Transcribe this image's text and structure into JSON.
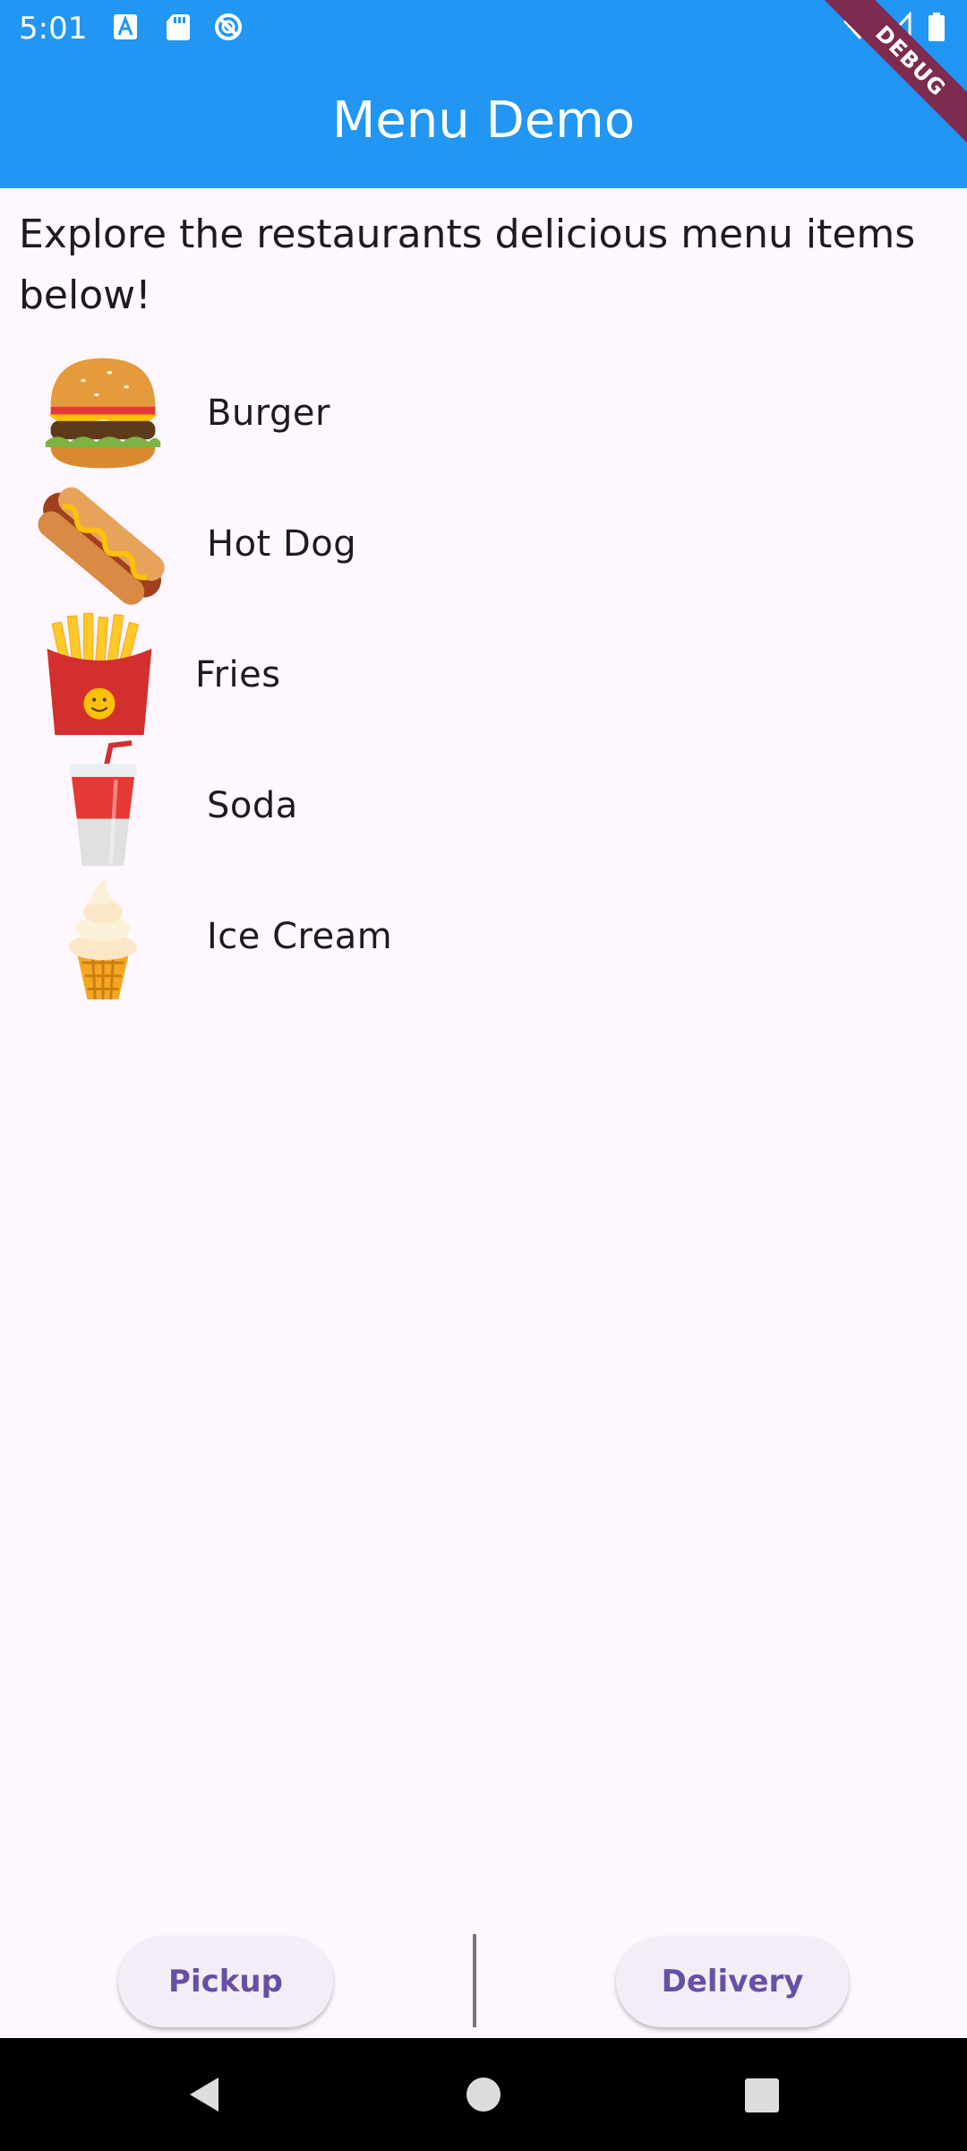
{
  "status_bar": {
    "time": "5:01",
    "left_icons": [
      "text-a-notification-icon",
      "sd-card-icon",
      "do-not-disturb-icon"
    ],
    "right_icons": [
      "wifi-icon",
      "cell-signal-icon",
      "battery-icon"
    ]
  },
  "app_bar": {
    "title": "Menu Demo",
    "color": "#2196F3"
  },
  "debug_banner": "DEBUG",
  "intro_text": "Explore the restaurants delicious menu items below!",
  "menu_items": [
    {
      "label": "Burger",
      "icon": "burger-icon"
    },
    {
      "label": "Hot Dog",
      "icon": "hot-dog-icon"
    },
    {
      "label": "Fries",
      "icon": "fries-icon"
    },
    {
      "label": "Soda",
      "icon": "soda-icon"
    },
    {
      "label": "Ice Cream",
      "icon": "ice-cream-icon"
    }
  ],
  "buttons": {
    "pickup": "Pickup",
    "delivery": "Delivery",
    "text_color": "#6750A4",
    "background": "#F3EDF7"
  },
  "nav_bar": {
    "icons": [
      "back-icon",
      "home-icon",
      "recents-icon"
    ]
  }
}
